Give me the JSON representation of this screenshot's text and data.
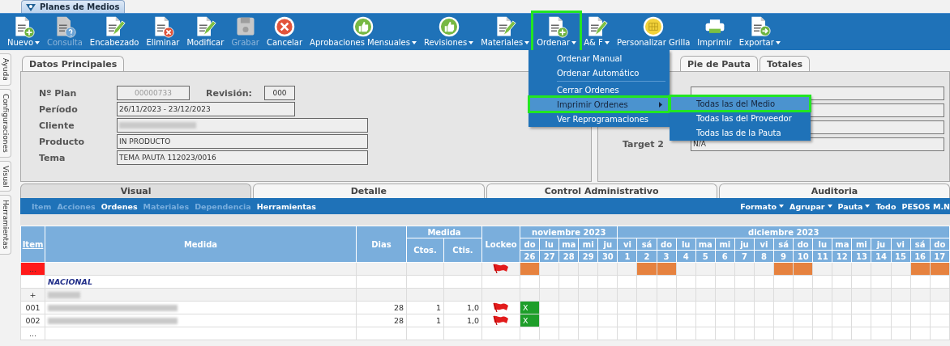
{
  "window_tab": {
    "title": "Planes de Medios"
  },
  "toolbar": [
    {
      "label": "Nuevo",
      "kind": "doc-plus",
      "caret": true,
      "disabled": false,
      "highlighted": false
    },
    {
      "label": "Consulta",
      "kind": "doc-question",
      "caret": false,
      "disabled": true,
      "highlighted": false
    },
    {
      "label": "Encabezado",
      "kind": "doc-pencil",
      "caret": false,
      "disabled": false,
      "highlighted": false
    },
    {
      "label": "Eliminar",
      "kind": "doc-x",
      "caret": false,
      "disabled": false,
      "highlighted": false
    },
    {
      "label": "Modificar",
      "kind": "doc-pencil",
      "caret": false,
      "disabled": false,
      "highlighted": false
    },
    {
      "label": "Grabar",
      "kind": "floppy",
      "caret": false,
      "disabled": true,
      "highlighted": false
    },
    {
      "label": "Cancelar",
      "kind": "cancel",
      "caret": false,
      "disabled": false,
      "highlighted": false
    },
    {
      "label": "Aprobaciones Mensuales",
      "kind": "thumb",
      "caret": true,
      "disabled": false,
      "highlighted": false
    },
    {
      "label": "Revisiones",
      "kind": "thumb",
      "caret": true,
      "disabled": false,
      "highlighted": false
    },
    {
      "label": "Materiales",
      "kind": "doc-pencil",
      "caret": true,
      "disabled": false,
      "highlighted": false
    },
    {
      "label": "Ordenar",
      "kind": "doc-plus",
      "caret": true,
      "disabled": false,
      "highlighted": true
    },
    {
      "label": "A& F",
      "kind": "doc-pencil",
      "caret": true,
      "disabled": false,
      "highlighted": false
    },
    {
      "label": "Personalizar Grilla",
      "kind": "grid",
      "caret": false,
      "disabled": false,
      "highlighted": false
    },
    {
      "label": "Imprimir",
      "kind": "printer",
      "caret": false,
      "disabled": false,
      "highlighted": false
    },
    {
      "label": "Exportar",
      "kind": "doc-arrow",
      "caret": true,
      "disabled": false,
      "highlighted": false
    }
  ],
  "side_tabs": [
    {
      "label": "Ayuda"
    },
    {
      "label": "Configuraciones"
    },
    {
      "label": "Visual"
    },
    {
      "label": "Herramientas"
    }
  ],
  "datos_principales": {
    "tab": "Datos Principales",
    "plan": {
      "label": "Nº Plan",
      "value": "00000733",
      "disabled": true
    },
    "revision": {
      "label": "Revisión:",
      "value": "000"
    },
    "fields": [
      {
        "label": "Período",
        "value": "26/11/2023 - 23/12/2023",
        "redacted": false
      },
      {
        "label": "Cliente",
        "redacted": true
      },
      {
        "label": "Producto",
        "value": "IN PRODUCTO",
        "redacted": false
      },
      {
        "label": "Tema",
        "value": "TEMA PAUTA 112023/0016",
        "redacted": false
      }
    ]
  },
  "right_panel": {
    "tabs": [
      {
        "label": "Pie de Pauta"
      },
      {
        "label": "Totales"
      }
    ],
    "rows": [
      {
        "kind": "blank"
      },
      {
        "kind": "blank"
      },
      {
        "kind": "blank"
      },
      {
        "kind": "labeled",
        "label": "Target 2",
        "value": "N/A"
      }
    ]
  },
  "lower_tabs": [
    {
      "label": "Visual",
      "selected": true
    },
    {
      "label": "Detalle",
      "selected": false
    },
    {
      "label": "Control Administrativo",
      "selected": false
    },
    {
      "label": "Auditoria",
      "selected": false
    }
  ],
  "subtoolbar": {
    "left": [
      {
        "label": "Item",
        "disabled": true
      },
      {
        "label": "Acciones",
        "disabled": true
      },
      {
        "label": "Ordenes",
        "disabled": false
      },
      {
        "label": "Materiales",
        "disabled": true
      },
      {
        "label": "Dependencia",
        "disabled": true
      },
      {
        "label": "Herramientas",
        "disabled": false
      }
    ],
    "right": [
      {
        "label": "Formato",
        "caret": true
      },
      {
        "label": "Agrupar",
        "caret": true
      },
      {
        "label": "Pauta",
        "caret": true
      },
      {
        "label": "Todo",
        "caret": false
      },
      {
        "label": "PESOS M.N",
        "caret": false
      }
    ]
  },
  "grid": {
    "columns": {
      "item": "Item",
      "medida": "Medida",
      "dias": "Dias",
      "medida_group": "Medida",
      "ctos": "Ctos.",
      "ctis": "Ctis.",
      "lockeo": "Lockeo"
    },
    "months": [
      {
        "label": "noviembre 2023",
        "days": [
          {
            "weekday": "do",
            "day": "26"
          },
          {
            "weekday": "lu",
            "day": "27"
          },
          {
            "weekday": "ma",
            "day": "28"
          },
          {
            "weekday": "mi",
            "day": "29"
          },
          {
            "weekday": "ju",
            "day": "30"
          }
        ]
      },
      {
        "label": "diciembre 2023",
        "days": [
          {
            "weekday": "vi",
            "day": "1"
          },
          {
            "weekday": "sá",
            "day": "2"
          },
          {
            "weekday": "do",
            "day": "3"
          },
          {
            "weekday": "lu",
            "day": "4"
          },
          {
            "weekday": "ma",
            "day": "5"
          },
          {
            "weekday": "mi",
            "day": "6"
          },
          {
            "weekday": "ju",
            "day": "7"
          },
          {
            "weekday": "vi",
            "day": "8"
          },
          {
            "weekday": "sá",
            "day": "9"
          },
          {
            "weekday": "do",
            "day": "10"
          },
          {
            "weekday": "lu",
            "day": "11"
          },
          {
            "weekday": "ma",
            "day": "12"
          },
          {
            "weekday": "mi",
            "day": "13"
          },
          {
            "weekday": "ju",
            "day": "14"
          },
          {
            "weekday": "vi",
            "day": "15"
          },
          {
            "weekday": "sá",
            "day": "16"
          },
          {
            "weekday": "do",
            "day": "17"
          }
        ]
      }
    ],
    "rows": [
      {
        "kind": "marker",
        "item": "...",
        "locked": true,
        "cells": [
          {
            "kind": "weekend"
          },
          {
            "kind": "blank"
          },
          {
            "kind": "blank"
          },
          {
            "kind": "blank"
          },
          {
            "kind": "blank"
          },
          {
            "kind": "blank"
          },
          {
            "kind": "weekend"
          },
          {
            "kind": "weekend"
          },
          {
            "kind": "blank"
          },
          {
            "kind": "blank"
          },
          {
            "kind": "blank"
          },
          {
            "kind": "blank"
          },
          {
            "kind": "blank"
          },
          {
            "kind": "weekend"
          },
          {
            "kind": "weekend"
          },
          {
            "kind": "blank"
          },
          {
            "kind": "blank"
          },
          {
            "kind": "blank"
          },
          {
            "kind": "blank"
          },
          {
            "kind": "blank"
          },
          {
            "kind": "weekend"
          },
          {
            "kind": "weekend"
          }
        ]
      },
      {
        "kind": "group",
        "medida": "NACIONAL",
        "locked": false
      },
      {
        "kind": "subgroup",
        "item": "+",
        "redacted": true,
        "locked": false
      },
      {
        "kind": "item",
        "item": "001",
        "redacted": true,
        "dias": "28",
        "ctos": "1",
        "ctis": "1,0",
        "locked": true,
        "cells": [
          {
            "kind": "spot",
            "text": "X"
          }
        ]
      },
      {
        "kind": "item",
        "item": "002",
        "redacted": true,
        "dias": "28",
        "ctos": "1",
        "ctis": "1,0",
        "locked": true,
        "cells": [
          {
            "kind": "spot",
            "text": "X"
          }
        ]
      },
      {
        "kind": "more",
        "item": "...",
        "locked": false
      }
    ]
  },
  "menu": {
    "items": [
      {
        "kind": "item",
        "label": "Ordenar Manual",
        "selected": false,
        "submenu": false,
        "highlighted": false
      },
      {
        "kind": "item",
        "label": "Ordenar Automático",
        "selected": false,
        "submenu": false,
        "highlighted": false
      },
      {
        "kind": "separator"
      },
      {
        "kind": "item",
        "label": "Cerrar Ordenes",
        "selected": false,
        "submenu": false,
        "highlighted": false
      },
      {
        "kind": "item",
        "label": "Imprimir Ordenes",
        "selected": true,
        "submenu": true,
        "highlighted": true
      },
      {
        "kind": "item",
        "label": "Ver Reprogramaciones",
        "selected": false,
        "submenu": false,
        "highlighted": false
      }
    ]
  },
  "submenu": {
    "items": [
      {
        "label": "Todas las del Medio",
        "selected": true,
        "highlighted": true
      },
      {
        "label": "Todas las del Proveedor",
        "selected": false,
        "highlighted": false
      },
      {
        "label": "Todas las de la Pauta",
        "selected": false,
        "highlighted": false
      }
    ]
  }
}
